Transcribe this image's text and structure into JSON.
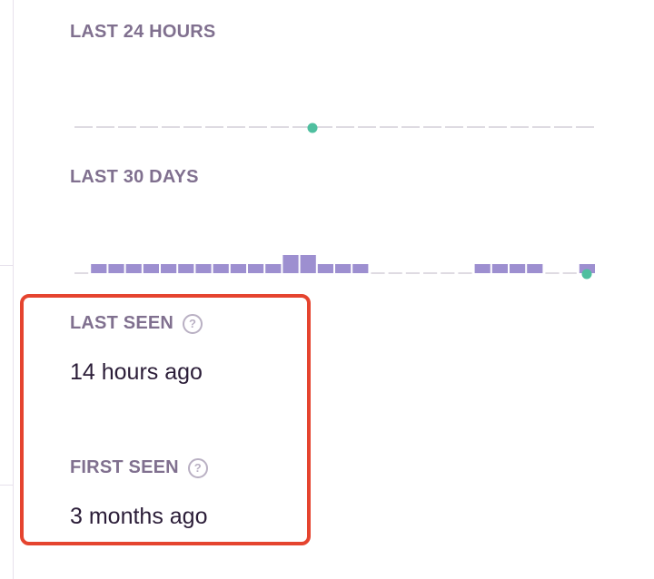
{
  "last_24_hours": {
    "label": "LAST 24 HOURS"
  },
  "last_30_days": {
    "label": "LAST 30 DAYS"
  },
  "last_seen": {
    "label": "LAST SEEN",
    "value": "14 hours ago",
    "help_icon": "question-circle-icon"
  },
  "first_seen": {
    "label": "FIRST SEEN",
    "value": "3 months ago",
    "help_icon": "question-circle-icon"
  },
  "colors": {
    "bar": "#9d8fd0",
    "release_marker": "#4fbf9f",
    "label": "#80708f",
    "value": "#2b1d38",
    "highlight": "#e5442f"
  },
  "chart_data": [
    {
      "type": "bar",
      "title": "LAST 24 HOURS",
      "values": [
        0,
        0,
        0,
        0,
        0,
        0,
        0,
        0,
        0,
        0,
        0,
        0,
        0,
        0,
        0,
        0,
        0,
        0,
        0,
        0,
        0,
        0,
        0,
        0
      ],
      "release_marker_index": 11
    },
    {
      "type": "bar",
      "title": "LAST 30 DAYS",
      "values": [
        0,
        1,
        1,
        1,
        1,
        1,
        1,
        1,
        1,
        1,
        1,
        1,
        2,
        2,
        1,
        1,
        1,
        0,
        0,
        0,
        0,
        0,
        0,
        1,
        1,
        1,
        1,
        0,
        0,
        1
      ],
      "release_marker_index": 30
    }
  ]
}
